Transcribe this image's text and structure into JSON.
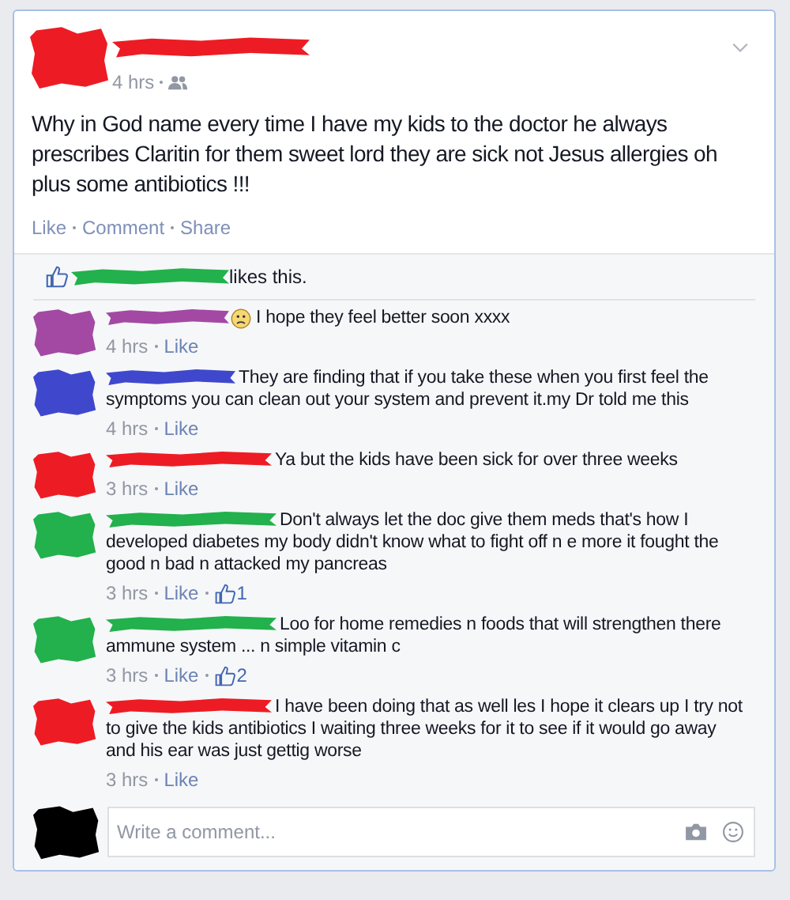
{
  "post": {
    "time": "4 hrs",
    "text": "Why in God name every time I have my kids to the doctor he always prescribes Claritin for them sweet lord they are sick not Jesus allergies oh plus some antibiotics !!!",
    "actions": [
      "Like",
      "Comment",
      "Share"
    ]
  },
  "likes": {
    "color": "#22b14c",
    "text": "likes this."
  },
  "comments": [
    {
      "color": "#a349a4",
      "kind": "emoji",
      "text": "I hope they feel better soon xxxx",
      "time": "4 hrs",
      "action": "Like"
    },
    {
      "color": "#3f48cc",
      "kind": "text",
      "text": "They are finding that if you take these when you first feel the symptoms you can clean out your system and prevent it.my Dr told me this",
      "time": "4 hrs",
      "action": "Like"
    },
    {
      "color": "#ed1c24",
      "kind": "text",
      "text": "Ya but the kids have been sick for over three weeks",
      "time": "3 hrs",
      "action": "Like"
    },
    {
      "color": "#22b14c",
      "kind": "text",
      "text": "Don't always let the doc give them meds that's how I developed diabetes my body didn't know what to fight off n e more it fought the good n bad n attacked my pancreas",
      "time": "3 hrs",
      "action": "Like",
      "likes": "1"
    },
    {
      "color": "#22b14c",
      "kind": "text",
      "text": "Loo for home remedies n foods that will strengthen there ammune system ... n simple vitamin c",
      "time": "3 hrs",
      "action": "Like",
      "likes": "2"
    },
    {
      "color": "#ed1c24",
      "kind": "text",
      "text": "I have been doing that as well les I hope it clears up I try not to give the kids antibiotics I waiting three weeks for it to see if it would go away and his ear was just gettig worse",
      "time": "3 hrs",
      "action": "Like"
    }
  ],
  "composer": {
    "placeholder": "Write a comment..."
  }
}
